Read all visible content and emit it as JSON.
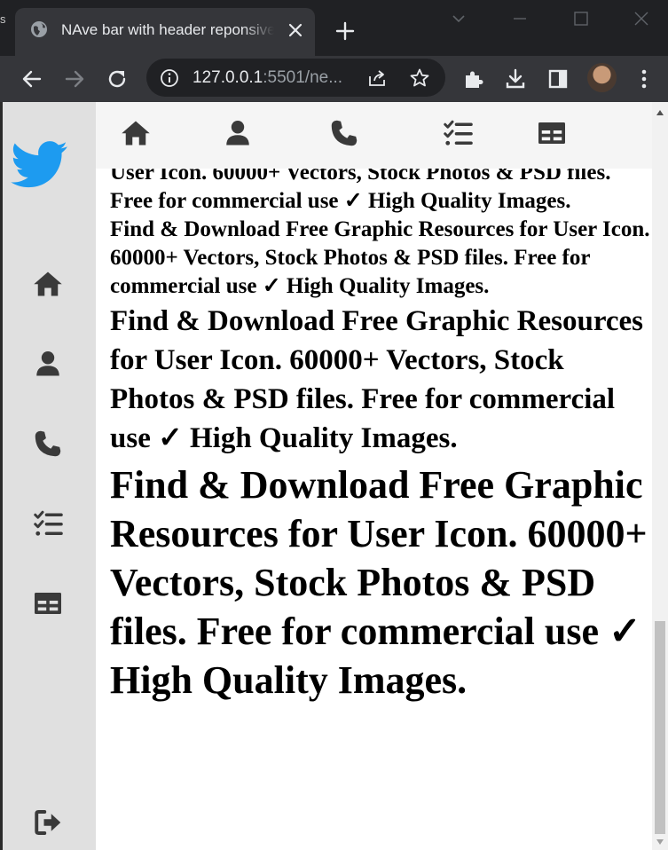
{
  "browser": {
    "tab": {
      "title": "NAve bar with header reponsive"
    },
    "address": {
      "host": "127.0.0.1",
      "rest": ":5501/ne..."
    },
    "edge_glyph": "s"
  },
  "content": {
    "paragraphs": [
      "User Icon. 60000+ Vectors, Stock Photos & PSD files. Free for commercial use ✓ High Quality Images.",
      "Find & Download Free Graphic Resources for User Icon. 60000+ Vectors, Stock Photos & PSD files. Free for commercial use ✓ High Quality Images.",
      "Find & Download Free Graphic Resources for User Icon. 60000+ Vectors, Stock Photos & PSD files. Free for commercial use ✓ High Quality Images.",
      "Find & Download Free Graphic Resources for User Icon. 60000+ Vectors, Stock Photos & PSD files. Free for commercial use ✓ High Quality Images."
    ]
  },
  "icons": {
    "sidebar": [
      "twitter-logo-icon",
      "home-icon",
      "user-icon",
      "phone-icon",
      "checklist-icon",
      "table-icon",
      "sign-out-icon"
    ],
    "topnav": [
      "home-icon",
      "user-icon",
      "phone-icon",
      "checklist-icon",
      "table-icon"
    ]
  },
  "colors": {
    "twitter_blue": "#1d9bf0",
    "sidebar_bg": "#e0e0e0",
    "topnav_bg": "#f5f5f5",
    "icon": "#3a3a3a",
    "chrome_dark": "#202124",
    "chrome_tab": "#35363a"
  }
}
